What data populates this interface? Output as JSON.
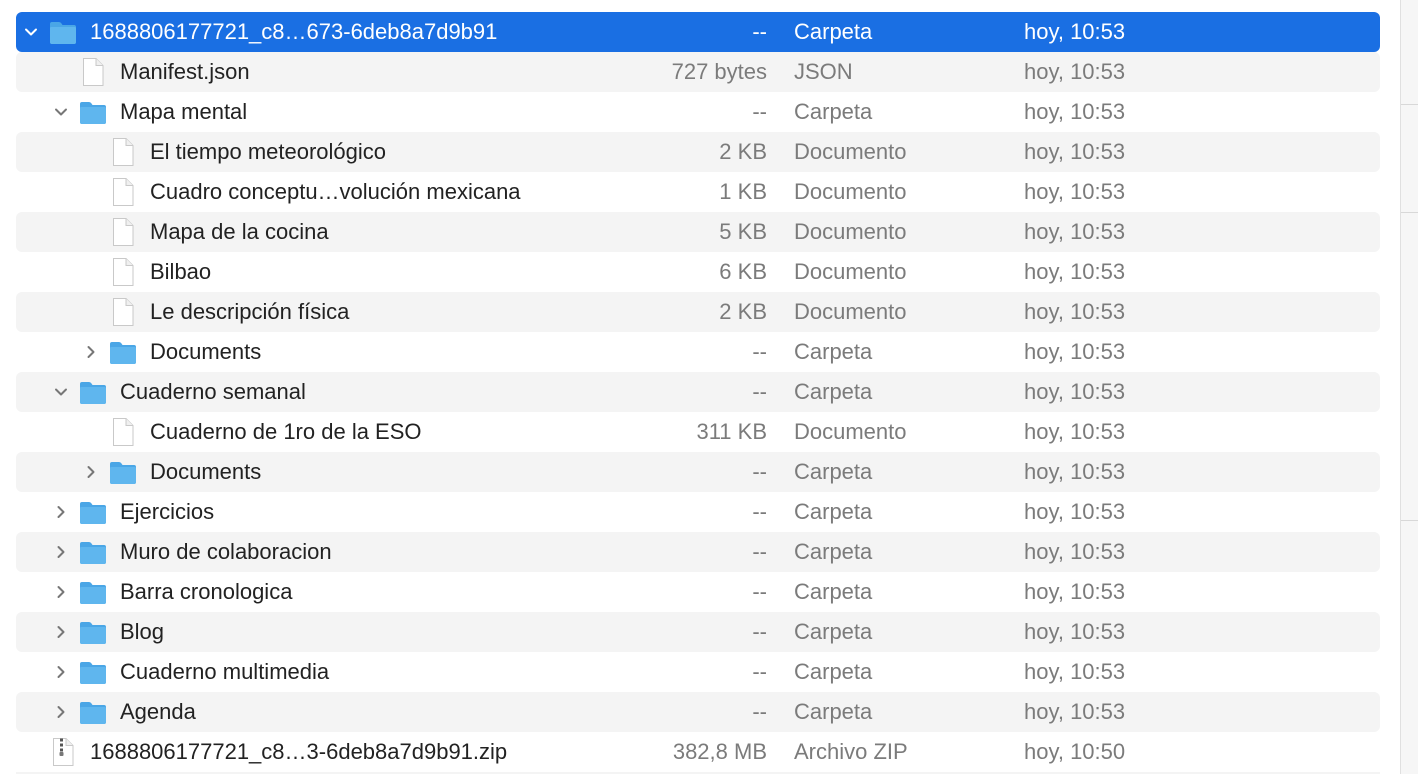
{
  "rows": [
    {
      "name": "1688806177721_c8…673-6deb8a7d9b91",
      "size": "--",
      "kind": "Carpeta",
      "date": "hoy, 10:53",
      "type": "folder",
      "depth": 0,
      "disclosure": "open",
      "selected": true
    },
    {
      "name": "Manifest.json",
      "size": "727 bytes",
      "kind": "JSON",
      "date": "hoy, 10:53",
      "type": "file",
      "depth": 1,
      "disclosure": "none"
    },
    {
      "name": "Mapa mental",
      "size": "--",
      "kind": "Carpeta",
      "date": "hoy, 10:53",
      "type": "folder",
      "depth": 1,
      "disclosure": "open"
    },
    {
      "name": "El tiempo meteorológico",
      "size": "2 KB",
      "kind": "Documento",
      "date": "hoy, 10:53",
      "type": "file",
      "depth": 2,
      "disclosure": "none"
    },
    {
      "name": "Cuadro conceptu…volución mexicana",
      "size": "1 KB",
      "kind": "Documento",
      "date": "hoy, 10:53",
      "type": "file",
      "depth": 2,
      "disclosure": "none"
    },
    {
      "name": "Mapa de la cocina",
      "size": "5 KB",
      "kind": "Documento",
      "date": "hoy, 10:53",
      "type": "file",
      "depth": 2,
      "disclosure": "none"
    },
    {
      "name": "Bilbao",
      "size": "6 KB",
      "kind": "Documento",
      "date": "hoy, 10:53",
      "type": "file",
      "depth": 2,
      "disclosure": "none"
    },
    {
      "name": "Le descripción física",
      "size": "2 KB",
      "kind": "Documento",
      "date": "hoy, 10:53",
      "type": "file",
      "depth": 2,
      "disclosure": "none"
    },
    {
      "name": "Documents",
      "size": "--",
      "kind": "Carpeta",
      "date": "hoy, 10:53",
      "type": "folder",
      "depth": 2,
      "disclosure": "closed"
    },
    {
      "name": "Cuaderno semanal",
      "size": "--",
      "kind": "Carpeta",
      "date": "hoy, 10:53",
      "type": "folder",
      "depth": 1,
      "disclosure": "open"
    },
    {
      "name": "Cuaderno de 1ro de la ESO",
      "size": "311 KB",
      "kind": "Documento",
      "date": "hoy, 10:53",
      "type": "file",
      "depth": 2,
      "disclosure": "none"
    },
    {
      "name": "Documents",
      "size": "--",
      "kind": "Carpeta",
      "date": "hoy, 10:53",
      "type": "folder",
      "depth": 2,
      "disclosure": "closed"
    },
    {
      "name": "Ejercicios",
      "size": "--",
      "kind": "Carpeta",
      "date": "hoy, 10:53",
      "type": "folder",
      "depth": 1,
      "disclosure": "closed"
    },
    {
      "name": "Muro de colaboracion",
      "size": "--",
      "kind": "Carpeta",
      "date": "hoy, 10:53",
      "type": "folder",
      "depth": 1,
      "disclosure": "closed"
    },
    {
      "name": "Barra cronologica",
      "size": "--",
      "kind": "Carpeta",
      "date": "hoy, 10:53",
      "type": "folder",
      "depth": 1,
      "disclosure": "closed"
    },
    {
      "name": "Blog",
      "size": "--",
      "kind": "Carpeta",
      "date": "hoy, 10:53",
      "type": "folder",
      "depth": 1,
      "disclosure": "closed"
    },
    {
      "name": "Cuaderno multimedia",
      "size": "--",
      "kind": "Carpeta",
      "date": "hoy, 10:53",
      "type": "folder",
      "depth": 1,
      "disclosure": "closed"
    },
    {
      "name": "Agenda",
      "size": "--",
      "kind": "Carpeta",
      "date": "hoy, 10:53",
      "type": "folder",
      "depth": 1,
      "disclosure": "closed"
    },
    {
      "name": "1688806177721_c8…3-6deb8a7d9b91.zip",
      "size": "382,8 MB",
      "kind": "Archivo ZIP",
      "date": "hoy, 10:50",
      "type": "zip",
      "depth": 0,
      "disclosure": "none"
    }
  ],
  "colors": {
    "selection": "#1a6fe3",
    "stripe": "#f4f4f4",
    "folder": "#5fb6ee",
    "secondary_text": "#7b7b7b"
  }
}
